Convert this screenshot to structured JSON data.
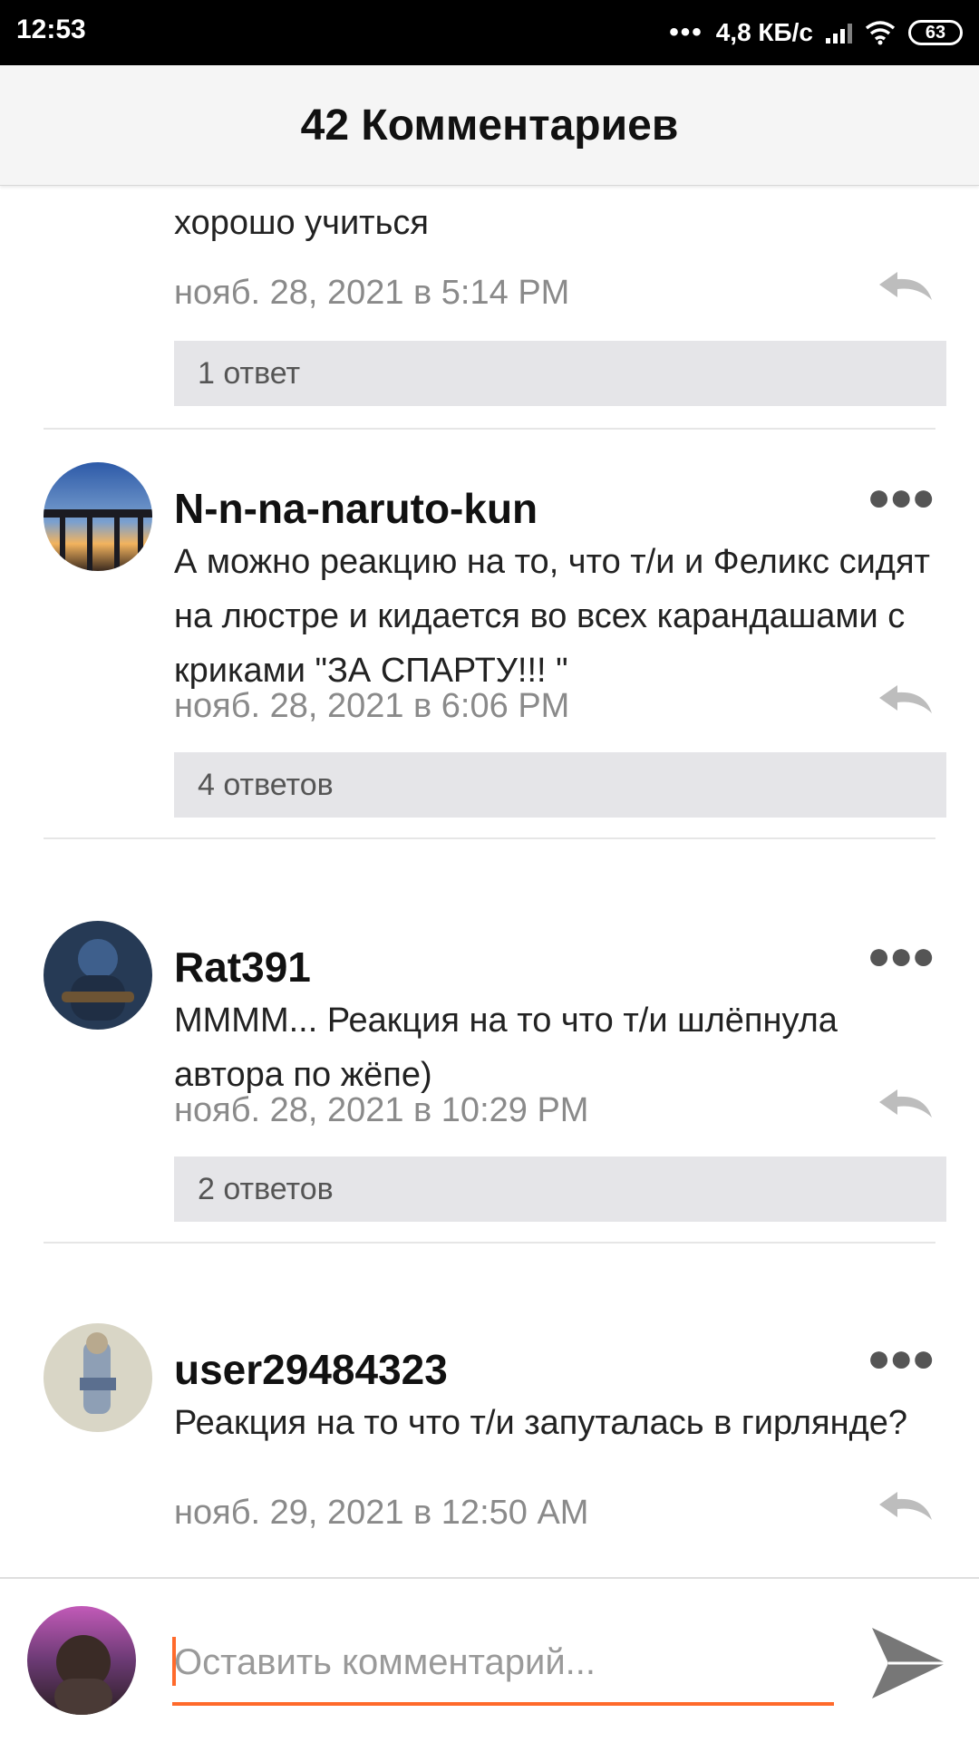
{
  "status_bar": {
    "time": "12:53",
    "network_speed": "4,8 КБ/с",
    "battery_level": "63",
    "icons": [
      "more-dots-icon",
      "signal-icon",
      "wifi-icon",
      "battery-icon"
    ]
  },
  "header": {
    "title": "42 Комментариев"
  },
  "comments": [
    {
      "username": "",
      "text": "хорошо учиться",
      "timestamp": "нояб. 28, 2021 в 5:14 PM",
      "replies": "1 ответ"
    },
    {
      "username": "N-n-na-naruto-kun",
      "text": "А можно реакцию на то, что т/и и Феликс сидят на люстре и кидается во всех карандашами с криками \"ЗА СПАРТУ!!! \"",
      "timestamp": "нояб. 28, 2021 в 6:06 PM",
      "replies": "4 ответов"
    },
    {
      "username": "Rat391",
      "text": "ММММ... Реакция на то что т/и шлёпнула автора по жёпе)",
      "timestamp": "нояб. 28, 2021 в 10:29 PM",
      "replies": "2 ответов"
    },
    {
      "username": "user29484323",
      "text": "Реакция на то что т/и запуталась в гирлянде?",
      "timestamp": "нояб. 29, 2021 в 12:50 AM",
      "replies": ""
    }
  ],
  "composer": {
    "placeholder": "Оставить комментарий..."
  },
  "colors": {
    "accent": "#ff6a2b",
    "reply_box": "#e5e5e8",
    "timestamp": "#8a8a8a"
  }
}
